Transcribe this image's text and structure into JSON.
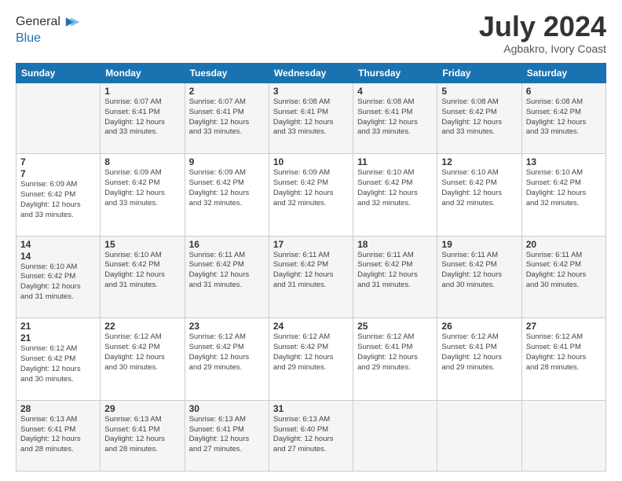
{
  "logo": {
    "line1": "General",
    "line2": "Blue"
  },
  "title": "July 2024",
  "location": "Agbakro, Ivory Coast",
  "days_of_week": [
    "Sunday",
    "Monday",
    "Tuesday",
    "Wednesday",
    "Thursday",
    "Friday",
    "Saturday"
  ],
  "weeks": [
    [
      {
        "day": "",
        "info": ""
      },
      {
        "day": "1",
        "info": "Sunrise: 6:07 AM\nSunset: 6:41 PM\nDaylight: 12 hours\nand 33 minutes."
      },
      {
        "day": "2",
        "info": "Sunrise: 6:07 AM\nSunset: 6:41 PM\nDaylight: 12 hours\nand 33 minutes."
      },
      {
        "day": "3",
        "info": "Sunrise: 6:08 AM\nSunset: 6:41 PM\nDaylight: 12 hours\nand 33 minutes."
      },
      {
        "day": "4",
        "info": "Sunrise: 6:08 AM\nSunset: 6:41 PM\nDaylight: 12 hours\nand 33 minutes."
      },
      {
        "day": "5",
        "info": "Sunrise: 6:08 AM\nSunset: 6:42 PM\nDaylight: 12 hours\nand 33 minutes."
      },
      {
        "day": "6",
        "info": "Sunrise: 6:08 AM\nSunset: 6:42 PM\nDaylight: 12 hours\nand 33 minutes."
      }
    ],
    [
      {
        "day": "7",
        "info": ""
      },
      {
        "day": "8",
        "info": "Sunrise: 6:09 AM\nSunset: 6:42 PM\nDaylight: 12 hours\nand 33 minutes."
      },
      {
        "day": "9",
        "info": "Sunrise: 6:09 AM\nSunset: 6:42 PM\nDaylight: 12 hours\nand 32 minutes."
      },
      {
        "day": "10",
        "info": "Sunrise: 6:09 AM\nSunset: 6:42 PM\nDaylight: 12 hours\nand 32 minutes."
      },
      {
        "day": "11",
        "info": "Sunrise: 6:10 AM\nSunset: 6:42 PM\nDaylight: 12 hours\nand 32 minutes."
      },
      {
        "day": "12",
        "info": "Sunrise: 6:10 AM\nSunset: 6:42 PM\nDaylight: 12 hours\nand 32 minutes."
      },
      {
        "day": "13",
        "info": "Sunrise: 6:10 AM\nSunset: 6:42 PM\nDaylight: 12 hours\nand 32 minutes."
      }
    ],
    [
      {
        "day": "14",
        "info": ""
      },
      {
        "day": "15",
        "info": "Sunrise: 6:10 AM\nSunset: 6:42 PM\nDaylight: 12 hours\nand 31 minutes."
      },
      {
        "day": "16",
        "info": "Sunrise: 6:11 AM\nSunset: 6:42 PM\nDaylight: 12 hours\nand 31 minutes."
      },
      {
        "day": "17",
        "info": "Sunrise: 6:11 AM\nSunset: 6:42 PM\nDaylight: 12 hours\nand 31 minutes."
      },
      {
        "day": "18",
        "info": "Sunrise: 6:11 AM\nSunset: 6:42 PM\nDaylight: 12 hours\nand 31 minutes."
      },
      {
        "day": "19",
        "info": "Sunrise: 6:11 AM\nSunset: 6:42 PM\nDaylight: 12 hours\nand 30 minutes."
      },
      {
        "day": "20",
        "info": "Sunrise: 6:11 AM\nSunset: 6:42 PM\nDaylight: 12 hours\nand 30 minutes."
      }
    ],
    [
      {
        "day": "21",
        "info": ""
      },
      {
        "day": "22",
        "info": "Sunrise: 6:12 AM\nSunset: 6:42 PM\nDaylight: 12 hours\nand 30 minutes."
      },
      {
        "day": "23",
        "info": "Sunrise: 6:12 AM\nSunset: 6:42 PM\nDaylight: 12 hours\nand 29 minutes."
      },
      {
        "day": "24",
        "info": "Sunrise: 6:12 AM\nSunset: 6:42 PM\nDaylight: 12 hours\nand 29 minutes."
      },
      {
        "day": "25",
        "info": "Sunrise: 6:12 AM\nSunset: 6:41 PM\nDaylight: 12 hours\nand 29 minutes."
      },
      {
        "day": "26",
        "info": "Sunrise: 6:12 AM\nSunset: 6:41 PM\nDaylight: 12 hours\nand 29 minutes."
      },
      {
        "day": "27",
        "info": "Sunrise: 6:12 AM\nSunset: 6:41 PM\nDaylight: 12 hours\nand 28 minutes."
      }
    ],
    [
      {
        "day": "28",
        "info": "Sunrise: 6:13 AM\nSunset: 6:41 PM\nDaylight: 12 hours\nand 28 minutes."
      },
      {
        "day": "29",
        "info": "Sunrise: 6:13 AM\nSunset: 6:41 PM\nDaylight: 12 hours\nand 28 minutes."
      },
      {
        "day": "30",
        "info": "Sunrise: 6:13 AM\nSunset: 6:41 PM\nDaylight: 12 hours\nand 27 minutes."
      },
      {
        "day": "31",
        "info": "Sunrise: 6:13 AM\nSunset: 6:40 PM\nDaylight: 12 hours\nand 27 minutes."
      },
      {
        "day": "",
        "info": ""
      },
      {
        "day": "",
        "info": ""
      },
      {
        "day": "",
        "info": ""
      }
    ]
  ]
}
